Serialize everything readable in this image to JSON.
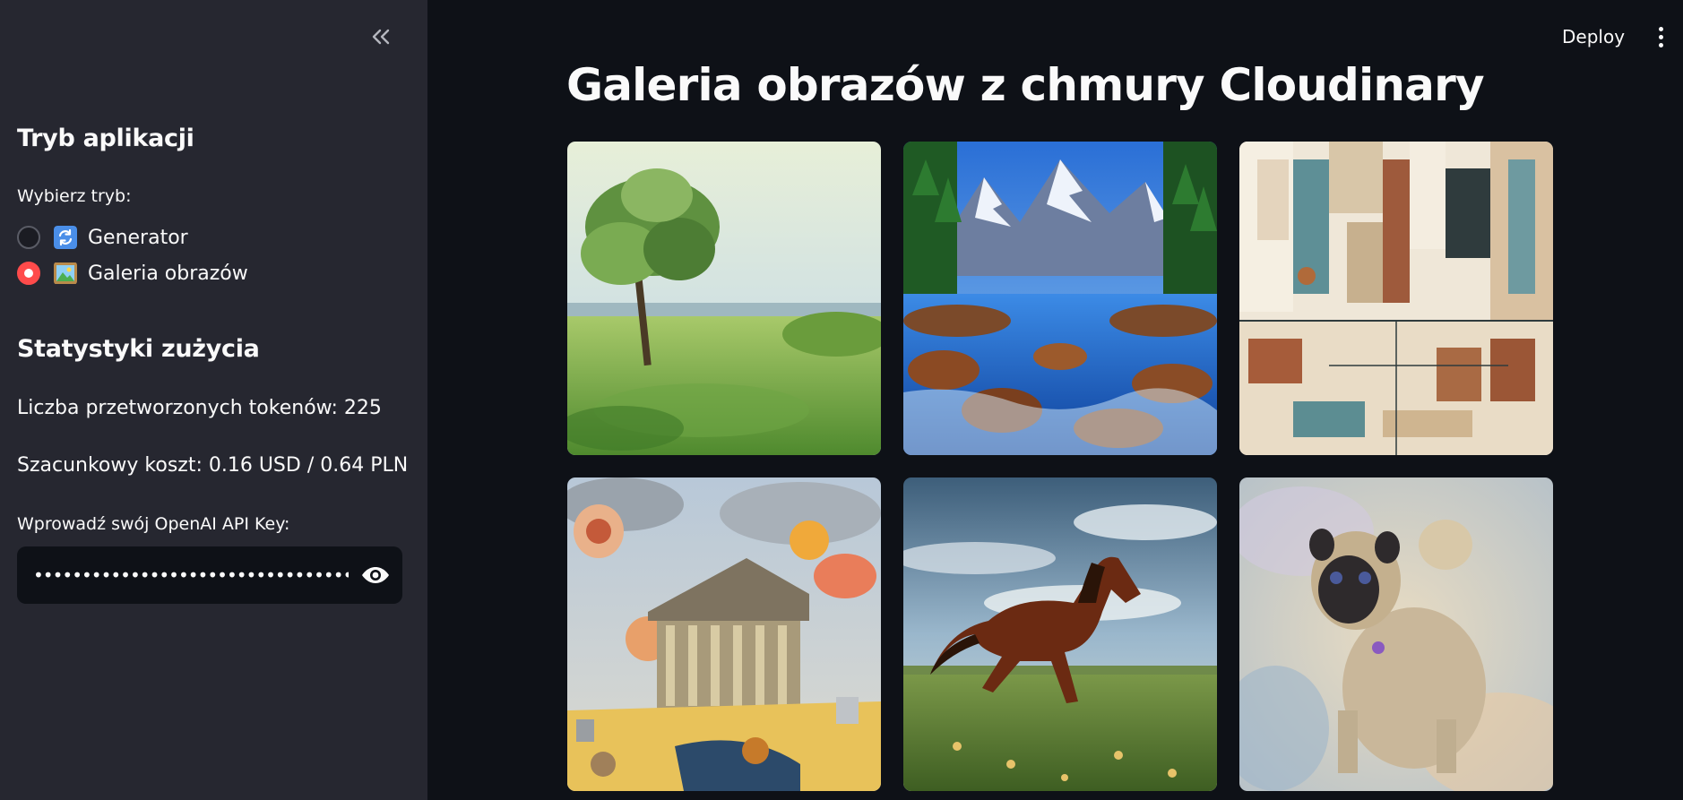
{
  "sidebar": {
    "collapse_icon": "double-chevron-left-icon",
    "mode_heading": "Tryb aplikacji",
    "mode_prompt": "Wybierz tryb:",
    "modes": [
      {
        "label": "Generator",
        "icon": "arrows-refresh-emoji",
        "selected": false
      },
      {
        "label": "Galeria obrazów",
        "icon": "framed-picture-emoji",
        "selected": true
      }
    ],
    "stats_heading": "Statystyki zużycia",
    "tokens_text": "Liczba przetworzonych tokenów: 225",
    "cost_text": "Szacunkowy koszt: 0.16 USD / 0.64 PLN",
    "api_key_label": "Wprowadź swój OpenAI API Key:",
    "api_key_value": "••••••••••••••••••••••••••••••••••••••••••",
    "api_key_toggle_icon": "eye-icon"
  },
  "header": {
    "deploy_label": "Deploy",
    "menu_icon": "vertical-ellipsis-icon"
  },
  "main": {
    "title": "Galeria obrazów z chmury Cloudinary",
    "gallery": [
      {
        "subject": "impressionist-tree-meadow"
      },
      {
        "subject": "mountain-river-forest"
      },
      {
        "subject": "cubist-barbershop-interior"
      },
      {
        "subject": "surreal-temple-floating-objects"
      },
      {
        "subject": "galloping-horse-meadow"
      },
      {
        "subject": "impressionist-pug"
      }
    ]
  },
  "colors": {
    "app_background": "#0e1117",
    "sidebar_background": "#262730",
    "accent": "#ff4b4b",
    "text": "#fafafa"
  }
}
